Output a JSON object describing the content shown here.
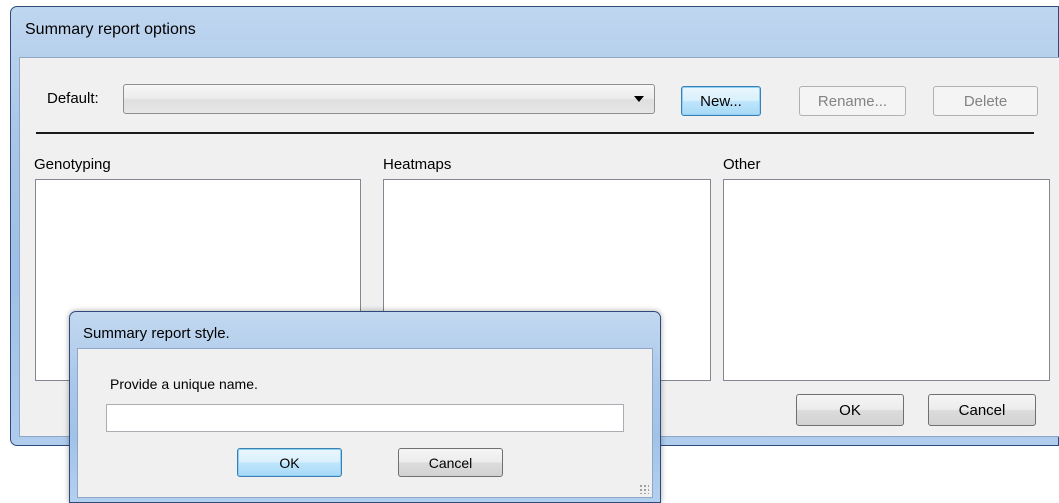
{
  "main_window": {
    "title": "Summary report options",
    "default_label": "Default:",
    "default_value": "",
    "buttons": {
      "new": "New...",
      "rename": "Rename...",
      "delete": "Delete",
      "ok": "OK",
      "cancel": "Cancel"
    },
    "lists": {
      "genotyping": "Genotyping",
      "heatmaps": "Heatmaps",
      "other": "Other"
    }
  },
  "child_dialog": {
    "title": "Summary report style.",
    "prompt": "Provide a unique name.",
    "name_value": "",
    "buttons": {
      "ok": "OK",
      "cancel": "Cancel"
    }
  }
}
